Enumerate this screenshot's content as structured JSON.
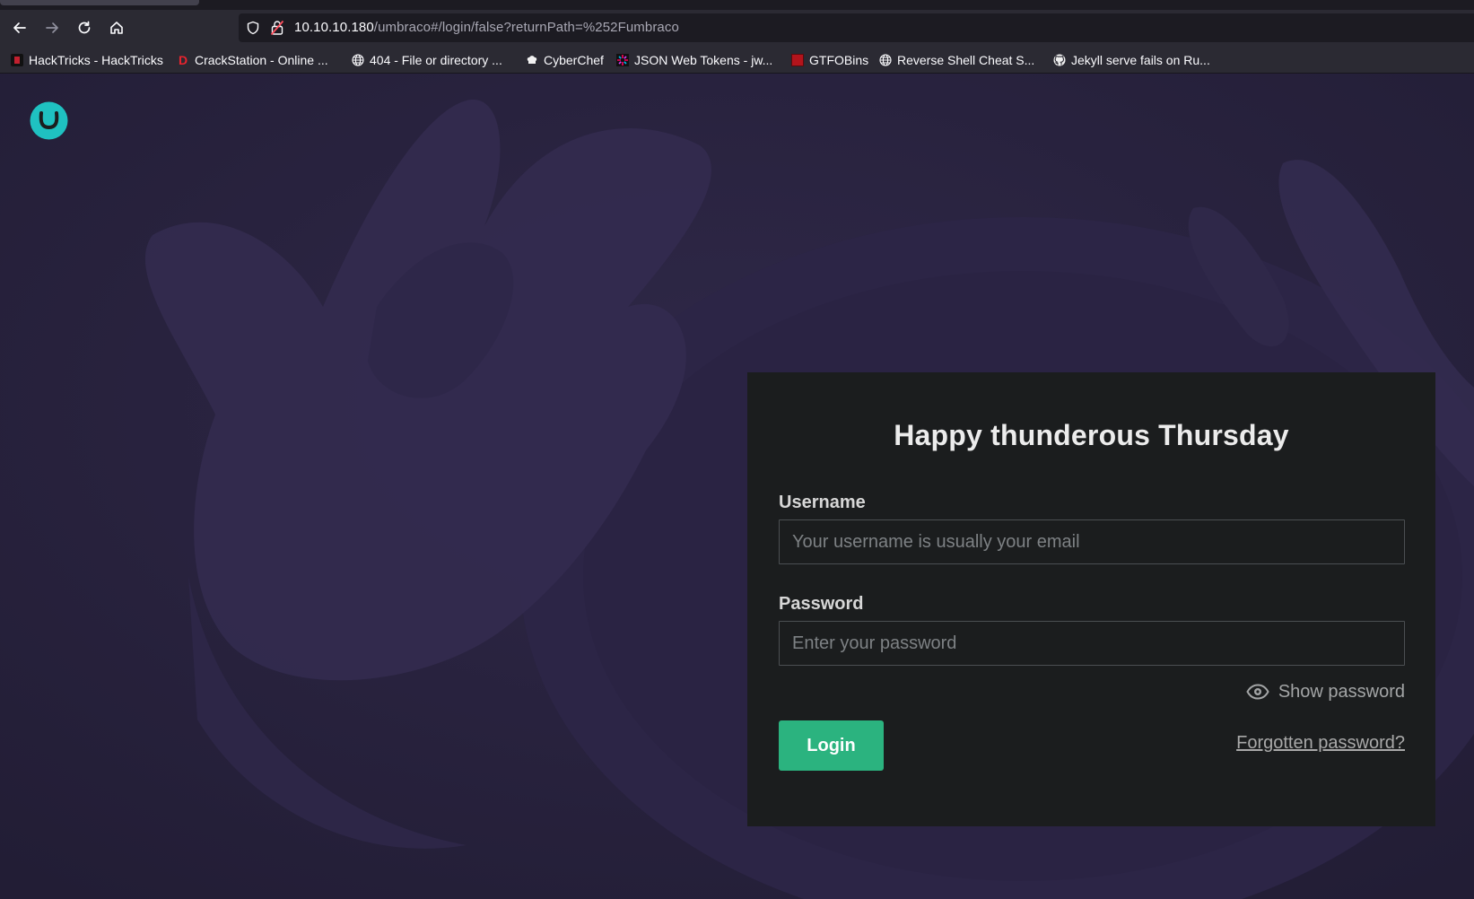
{
  "browser": {
    "url_host": "10.10.10.180",
    "url_path": "/umbraco#/login/false?returnPath=%252Fumbraco",
    "bookmarks": [
      {
        "label": "HackTricks - HackTricks",
        "icon": "hacktricks-icon"
      },
      {
        "label": "CrackStation - Online ...",
        "icon": "crackstation-icon"
      },
      {
        "label": "404 - File or directory ...",
        "icon": "globe-icon"
      },
      {
        "label": "CyberChef",
        "icon": "cyberchef-icon"
      },
      {
        "label": "JSON Web Tokens - jw...",
        "icon": "jwt-icon"
      },
      {
        "label": "GTFOBins",
        "icon": "gtfobins-icon"
      },
      {
        "label": "Reverse Shell Cheat S...",
        "icon": "globe-icon"
      },
      {
        "label": "Jekyll serve fails on Ru...",
        "icon": "github-icon"
      }
    ]
  },
  "login": {
    "greeting": "Happy thunderous Thursday",
    "username_label": "Username",
    "username_placeholder": "Your username is usually your email",
    "password_label": "Password",
    "password_placeholder": "Enter your password",
    "show_password": "Show password",
    "login_button": "Login",
    "forgot_password": "Forgotten password?"
  },
  "colors": {
    "brand": "#1fc1c1",
    "login_button": "#2bb37f",
    "background": "#2a2440",
    "card": "#1b1d1e"
  }
}
